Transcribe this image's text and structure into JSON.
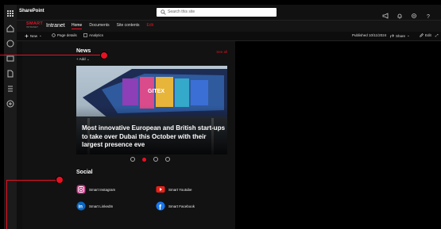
{
  "app": {
    "name": "SharePoint"
  },
  "search": {
    "placeholder": "Search this site"
  },
  "site": {
    "logo_top": "SMART",
    "logo_bottom": "INTRANET",
    "name": "Intranet",
    "nav": [
      {
        "label": "Home",
        "active": true
      },
      {
        "label": "Documents"
      },
      {
        "label": "Site contents"
      },
      {
        "label": "Edit",
        "accent": true
      }
    ]
  },
  "commands": {
    "new": "New",
    "page_details": "Page details",
    "analytics": "Analytics",
    "published": "Published 10/11/2024",
    "share": "Share",
    "edit": "Edit"
  },
  "news": {
    "title": "News",
    "see_all": "See all",
    "add": "Add",
    "headline": "Most innovative European and British start-ups to take over Dubai this October with their largest presence eve",
    "carousel": {
      "count": 4,
      "active_index": 1
    }
  },
  "social": {
    "title": "Social",
    "items": [
      {
        "label": "Smart Instagram",
        "icon": "instagram-icon"
      },
      {
        "label": "Smart Youtube",
        "icon": "youtube-icon"
      },
      {
        "label": "Smart LinkedIn",
        "icon": "linkedin-icon"
      },
      {
        "label": "Smart Facebook",
        "icon": "facebook-icon"
      }
    ]
  },
  "colors": {
    "accent": "#e81123",
    "background": "#000000",
    "panel": "#121212"
  }
}
